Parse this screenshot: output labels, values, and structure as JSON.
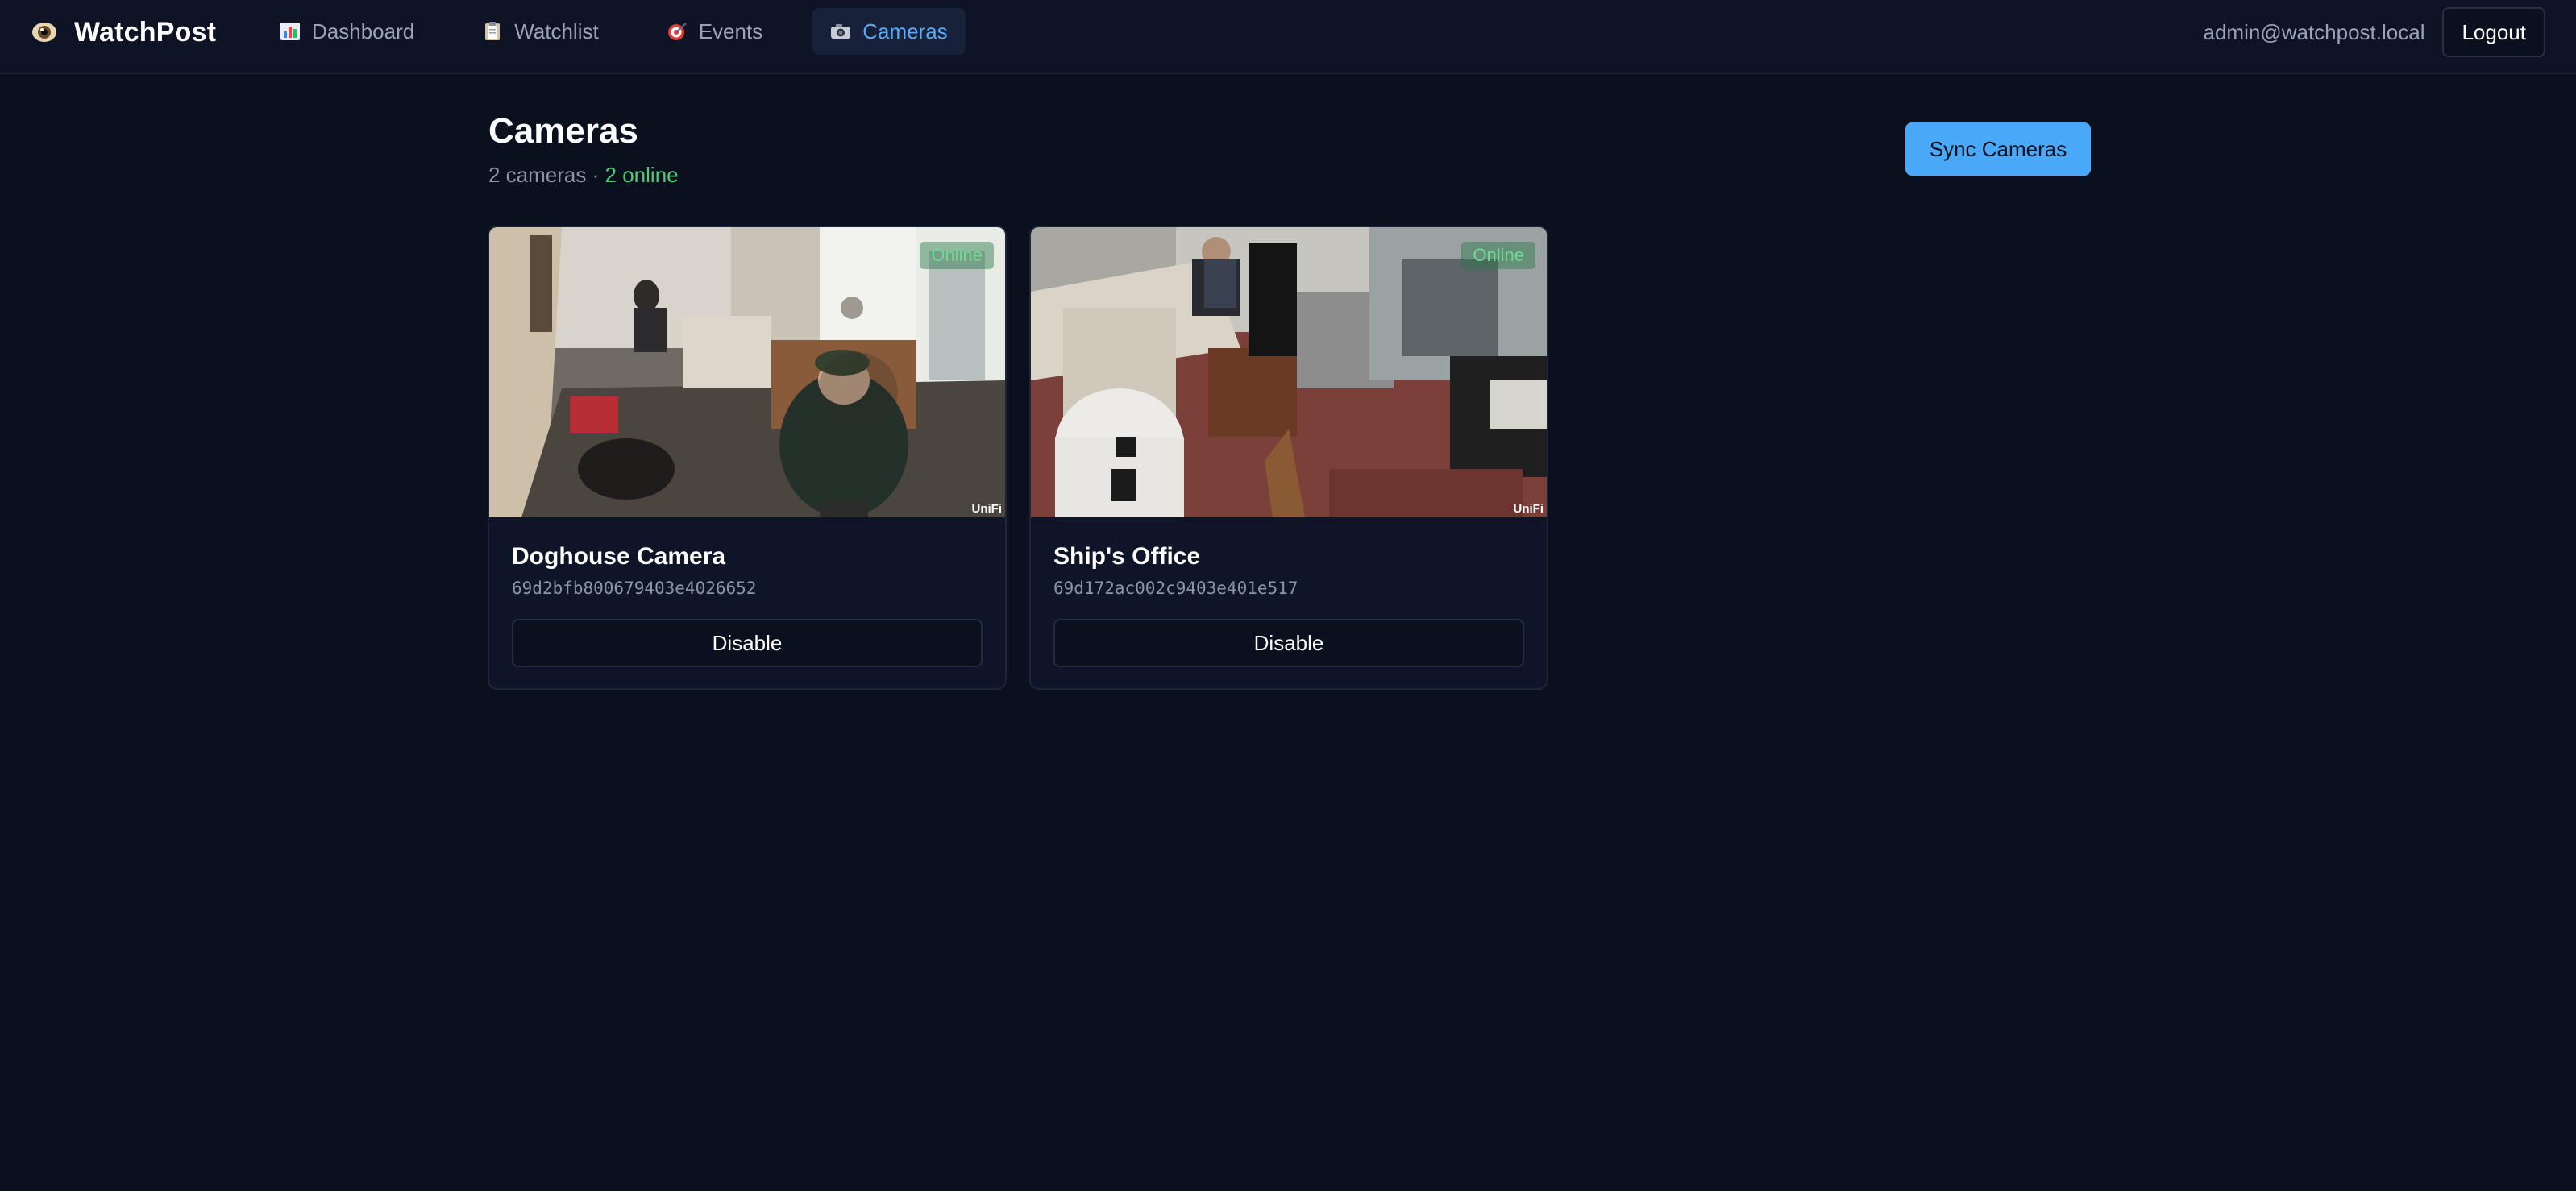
{
  "app": {
    "brand": "WatchPost",
    "brand_icon": "eye-icon"
  },
  "nav": {
    "items": [
      {
        "label": "Dashboard",
        "icon": "bar-chart-icon",
        "active": false
      },
      {
        "label": "Watchlist",
        "icon": "clipboard-icon",
        "active": false
      },
      {
        "label": "Events",
        "icon": "target-icon",
        "active": false
      },
      {
        "label": "Cameras",
        "icon": "camera-icon",
        "active": true
      }
    ]
  },
  "account": {
    "email": "admin@watchpost.local",
    "logout_label": "Logout"
  },
  "page": {
    "title": "Cameras",
    "camera_count": "2 cameras",
    "separator": "·",
    "online_count": "2 online",
    "sync_label": "Sync Cameras"
  },
  "cameras": [
    {
      "name": "Doghouse Camera",
      "id": "69d2bfb800679403e4026652",
      "status": "Online",
      "watermark": "UniFi",
      "action_label": "Disable"
    },
    {
      "name": "Ship's Office",
      "id": "69d172ac002c9403e401e517",
      "status": "Online",
      "watermark": "UniFi",
      "action_label": "Disable"
    }
  ],
  "colors": {
    "background": "#0b101e",
    "accent": "#4aa8f8",
    "online": "#4fcb76"
  }
}
